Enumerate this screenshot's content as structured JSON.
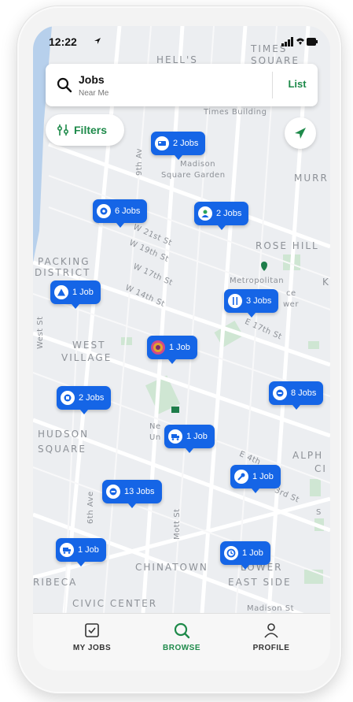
{
  "status_bar": {
    "time": "12:22"
  },
  "search": {
    "title": "Jobs",
    "subtitle": "Near Me",
    "list_label": "List"
  },
  "filters": {
    "label": "Filters"
  },
  "map_labels": {
    "hells": "HELL'S",
    "times_square": "TIMES SQUARE",
    "times_building": "Times Building",
    "madison1": "Madison",
    "madison2": "Square Garden",
    "murray": "MURR",
    "ninth_av": "9th Av",
    "rose_hill": "ROSE HILL",
    "packing1": "PACKING",
    "packing2": "DISTRICT",
    "metro1": "Metropolitan",
    "metro2": "ce",
    "metro3": "wer",
    "k": "K",
    "w21": "W 21st St",
    "w19": "W 19th St",
    "w17": "W 17th St",
    "w14": "W 14th St",
    "e17": "E 17th St",
    "west_st": "West St",
    "west_village1": "WEST",
    "west_village2": "VILLAGE",
    "hudson1": "HUDSON",
    "hudson2": "SQUARE",
    "ne": "Ne",
    "un": "Un",
    "e4": "E 4th",
    "alph": "ALPH",
    "ci": "CI",
    "third_st": "3rd St",
    "sixth_av": "6th Ave",
    "mott": "Mott St",
    "chinatown": "CHINATOWN",
    "lower": "LOWER",
    "east_side": "EAST SIDE",
    "ribeca": "RIBECA",
    "civic": "CIVIC CENTER",
    "madison_st": "Madison St",
    "st_letter": "S"
  },
  "pins": [
    {
      "label": "2 Jobs",
      "icon": "bed-icon"
    },
    {
      "label": "6 Jobs",
      "icon": "gear-icon"
    },
    {
      "label": "2 Jobs",
      "icon": "person-icon"
    },
    {
      "label": "1 Job",
      "icon": "triangle-icon"
    },
    {
      "label": "3 Jobs",
      "icon": "utensils-icon"
    },
    {
      "label": "1 Job",
      "icon": "photo-avatar"
    },
    {
      "label": "2 Jobs",
      "icon": "box-icon"
    },
    {
      "label": "8 Jobs",
      "icon": "stack-icon"
    },
    {
      "label": "1 Job",
      "icon": "truck-icon"
    },
    {
      "label": "1 Job",
      "icon": "wrench-icon"
    },
    {
      "label": "13 Jobs",
      "icon": "stack-icon"
    },
    {
      "label": "1 Job",
      "icon": "truck-icon"
    },
    {
      "label": "1 Job",
      "icon": "clock-icon"
    }
  ],
  "tabs": [
    {
      "label": "MY JOBS",
      "icon": "checklist-icon",
      "active": false
    },
    {
      "label": "BROWSE",
      "icon": "search-icon",
      "active": true
    },
    {
      "label": "PROFILE",
      "icon": "person-icon",
      "active": false
    }
  ],
  "colors": {
    "accent_green": "#1e8a4a",
    "pin_blue": "#1565e6",
    "park_green": "#cfe6d3",
    "water": "#a8c7ea"
  }
}
